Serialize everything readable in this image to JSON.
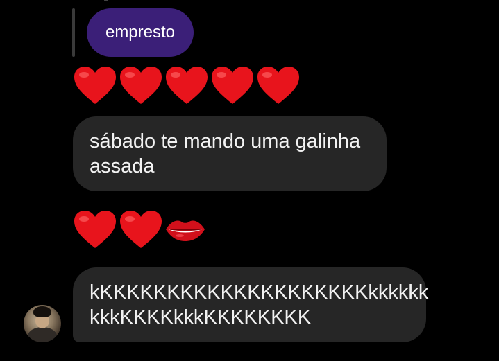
{
  "reply_preview": {
    "text": "empresto"
  },
  "messages": [
    {
      "type": "emoji",
      "emojis": [
        "red-heart",
        "red-heart",
        "red-heart",
        "red-heart",
        "red-heart"
      ]
    },
    {
      "type": "text",
      "lines": [
        "sábado te mando uma galinha",
        "assada"
      ]
    },
    {
      "type": "emoji",
      "emojis": [
        "red-heart",
        "red-heart",
        "kiss-mark-lips"
      ]
    },
    {
      "type": "text",
      "lines": [
        "kKKKKKKKKKKKKKKKKKKKKkkkkkk",
        "kkkKKKKkkkKKKKKKKK"
      ]
    }
  ],
  "colors": {
    "background": "#000000",
    "reply_bubble": "#3b1f78",
    "received_bubble": "#262626",
    "text": "#f2f2f2"
  }
}
